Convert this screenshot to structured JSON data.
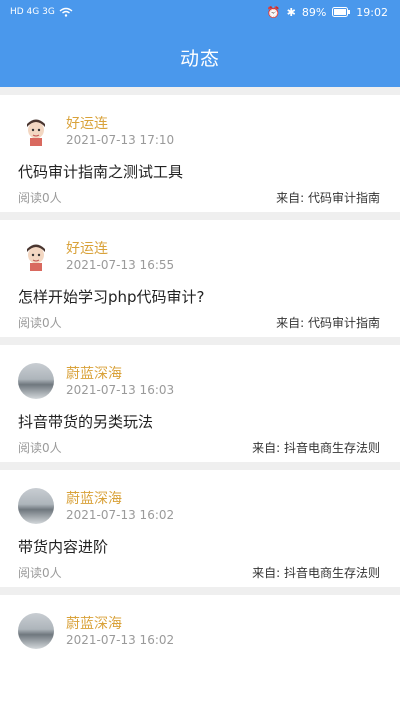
{
  "status": {
    "carrier_left": "HD 4G 3G",
    "battery_pct": "89%",
    "time": "19:02"
  },
  "page": {
    "title": "动态"
  },
  "feed": [
    {
      "author": "好运连",
      "time": "2021-07-13 17:10",
      "title": "代码审计指南之测试工具",
      "reads": "阅读0人",
      "source": "来自: 代码审计指南",
      "avatar": "cartoon-avatar"
    },
    {
      "author": "好运连",
      "time": "2021-07-13 16:55",
      "title": "怎样开始学习php代码审计?",
      "reads": "阅读0人",
      "source": "来自: 代码审计指南",
      "avatar": "cartoon-avatar"
    },
    {
      "author": "蔚蓝深海",
      "time": "2021-07-13 16:03",
      "title": "抖音带货的另类玩法",
      "reads": "阅读0人",
      "source": "来自: 抖音电商生存法则",
      "avatar": "sea-avatar"
    },
    {
      "author": "蔚蓝深海",
      "time": "2021-07-13 16:02",
      "title": "带货内容进阶",
      "reads": "阅读0人",
      "source": "来自: 抖音电商生存法则",
      "avatar": "sea-avatar"
    },
    {
      "author": "蔚蓝深海",
      "time": "2021-07-13 16:02",
      "title": "",
      "reads": "",
      "source": "",
      "avatar": "sea-avatar"
    }
  ]
}
